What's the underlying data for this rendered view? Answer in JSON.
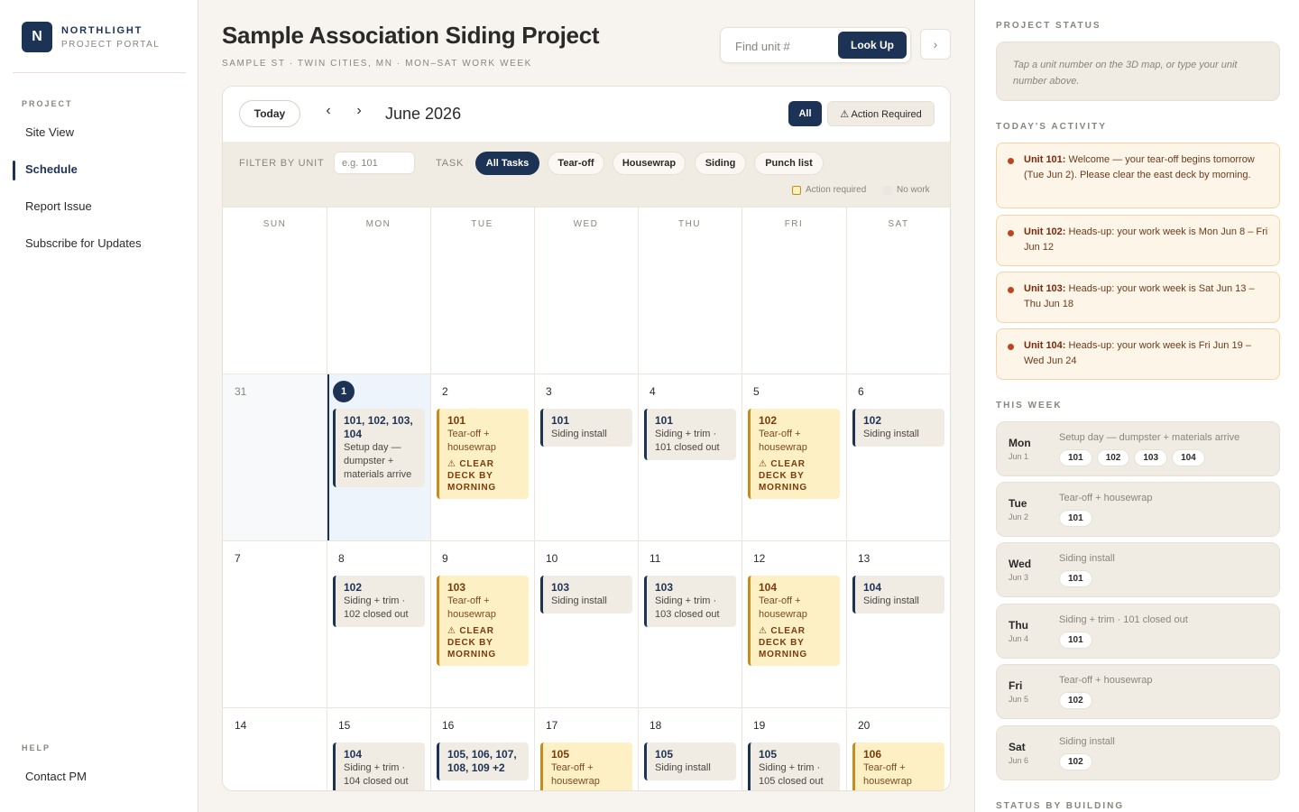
{
  "brand": {
    "name": "NORTHLIGHT",
    "sub": "PROJECT PORTAL",
    "initial": "N"
  },
  "sidebar": {
    "project_label": "PROJECT",
    "items": [
      {
        "label": "Site View"
      },
      {
        "label": "Schedule"
      },
      {
        "label": "Report Issue"
      },
      {
        "label": "Subscribe for Updates"
      }
    ],
    "help_label": "HELP",
    "help_items": [
      {
        "label": "Contact PM"
      }
    ]
  },
  "header": {
    "title": "Sample Association Siding Project",
    "subtitle": "SAMPLE ST · TWIN CITIES, MN · MON–SAT WORK WEEK",
    "search_placeholder": "Find unit #",
    "lookup_label": "Look Up",
    "collapse_icon": "chevron-right-icon"
  },
  "calendar": {
    "today_label": "Today",
    "prev_glyph": "‹",
    "next_glyph": "›",
    "month": "June 2026",
    "view_all": "All",
    "view_action": "⚠ Action Required",
    "filter_unit_label": "FILTER BY UNIT",
    "filter_unit_placeholder": "e.g. 101",
    "task_label": "TASK",
    "tasks": [
      "All Tasks",
      "Tear-off",
      "Housewrap",
      "Siding",
      "Punch list"
    ],
    "legend_action": "Action required",
    "legend_nowork": "No work",
    "weekdays": [
      "SUN",
      "MON",
      "TUE",
      "WED",
      "THU",
      "FRI",
      "SAT"
    ],
    "weeks": [
      [
        {
          "day": "31",
          "muted": true,
          "events": []
        },
        {
          "day": "1",
          "today": true,
          "events": [
            {
              "units": "101, 102, 103, 104",
              "task": "Setup day — dumpster + materials arrive"
            }
          ]
        },
        {
          "day": "2",
          "events": [
            {
              "units": "101",
              "task": "Tear-off + housewrap",
              "warn": "⚠ CLEAR DECK BY MORNING"
            }
          ]
        },
        {
          "day": "3",
          "events": [
            {
              "units": "101",
              "task": "Siding install"
            }
          ]
        },
        {
          "day": "4",
          "events": [
            {
              "units": "101",
              "task": "Siding + trim · 101 closed out"
            }
          ]
        },
        {
          "day": "5",
          "events": [
            {
              "units": "102",
              "task": "Tear-off + housewrap",
              "warn": "⚠ CLEAR DECK BY MORNING"
            }
          ]
        },
        {
          "day": "6",
          "events": [
            {
              "units": "102",
              "task": "Siding install"
            }
          ]
        }
      ],
      [
        {
          "day": "7",
          "events": []
        },
        {
          "day": "8",
          "events": [
            {
              "units": "102",
              "task": "Siding + trim · 102 closed out"
            }
          ]
        },
        {
          "day": "9",
          "events": [
            {
              "units": "103",
              "task": "Tear-off + housewrap",
              "warn": "⚠ CLEAR DECK BY MORNING"
            }
          ]
        },
        {
          "day": "10",
          "events": [
            {
              "units": "103",
              "task": "Siding install"
            }
          ]
        },
        {
          "day": "11",
          "events": [
            {
              "units": "103",
              "task": "Siding + trim · 103 closed out"
            }
          ]
        },
        {
          "day": "12",
          "events": [
            {
              "units": "104",
              "task": "Tear-off + housewrap",
              "warn": "⚠ CLEAR DECK BY MORNING"
            }
          ]
        },
        {
          "day": "13",
          "events": [
            {
              "units": "104",
              "task": "Siding install"
            }
          ]
        }
      ],
      [
        {
          "day": "14",
          "events": []
        },
        {
          "day": "15",
          "events": [
            {
              "units": "104",
              "task": "Siding + trim · 104 closed out"
            }
          ]
        },
        {
          "day": "16",
          "events": [
            {
              "units": "105, 106, 107, 108, 109 +2",
              "task": ""
            }
          ]
        },
        {
          "day": "17",
          "events": [
            {
              "units": "105",
              "task": "Tear-off + housewrap",
              "warn": ""
            }
          ]
        },
        {
          "day": "18",
          "events": [
            {
              "units": "105",
              "task": "Siding install"
            }
          ]
        },
        {
          "day": "19",
          "events": [
            {
              "units": "105",
              "task": "Siding + trim · 105 closed out"
            }
          ]
        },
        {
          "day": "20",
          "events": [
            {
              "units": "106",
              "task": "Tear-off + housewrap",
              "warn": ""
            }
          ]
        }
      ]
    ]
  },
  "right": {
    "status_label": "PROJECT STATUS",
    "status_hint": "Tap a unit number on the 3D map, or type your unit number above.",
    "activity_label": "TODAY'S ACTIVITY",
    "activity": [
      {
        "unit": "Unit 101:",
        "text": " Welcome — your tear-off begins tomorrow (Tue Jun 2). Please clear the east deck by morning."
      },
      {
        "unit": "Unit 102:",
        "text": " Heads-up: your work week is Mon Jun 8 – Fri Jun 12"
      },
      {
        "unit": "Unit 103:",
        "text": " Heads-up: your work week is Sat Jun 13 – Thu Jun 18"
      },
      {
        "unit": "Unit 104:",
        "text": " Heads-up: your work week is Fri Jun 19 – Wed Jun 24"
      }
    ],
    "week_label": "THIS WEEK",
    "week": [
      {
        "day": "Mon",
        "date": "Jun 1",
        "task": "Setup day — dumpster + materials arrive",
        "units": [
          "101",
          "102",
          "103",
          "104"
        ]
      },
      {
        "day": "Tue",
        "date": "Jun 2",
        "task": "Tear-off + housewrap",
        "units": [
          "101"
        ]
      },
      {
        "day": "Wed",
        "date": "Jun 3",
        "task": "Siding install",
        "units": [
          "101"
        ]
      },
      {
        "day": "Thu",
        "date": "Jun 4",
        "task": "Siding + trim · 101 closed out",
        "units": [
          "101"
        ]
      },
      {
        "day": "Fri",
        "date": "Jun 5",
        "task": "Tear-off + housewrap",
        "units": [
          "102"
        ]
      },
      {
        "day": "Sat",
        "date": "Jun 6",
        "task": "Siding install",
        "units": [
          "102"
        ]
      }
    ],
    "building_label": "STATUS BY BUILDING"
  },
  "colors": {
    "accent": "#1d3355",
    "action": "#c98a1e",
    "action_bg": "#fdf0c4",
    "alert_dot": "#c0441a"
  }
}
